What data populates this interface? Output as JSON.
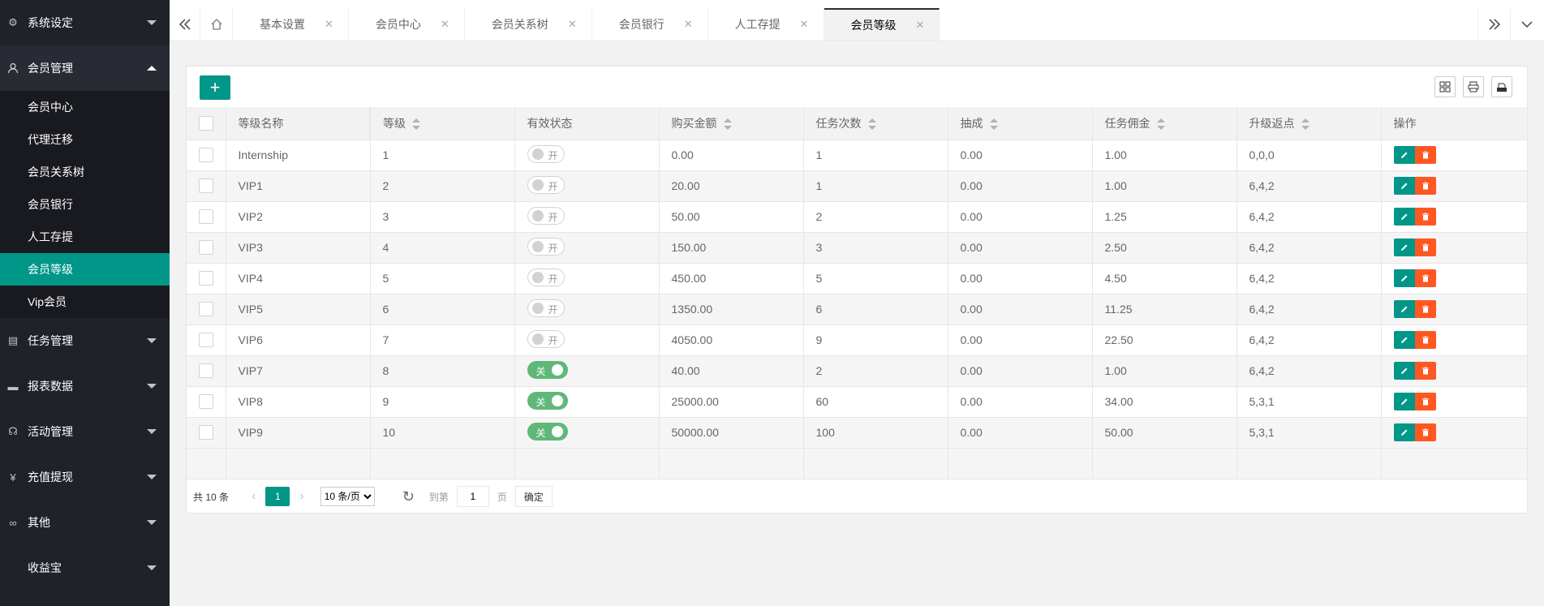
{
  "sidebar": {
    "groups": [
      {
        "label": "系统设定",
        "icon": "gear-icon"
      },
      {
        "label": "会员管理",
        "icon": "user-icon"
      },
      {
        "label": "任务管理",
        "icon": "document-icon"
      },
      {
        "label": "报表数据",
        "icon": "monitor-icon"
      },
      {
        "label": "活动管理",
        "icon": "headset-icon"
      },
      {
        "label": "充值提现",
        "icon": "yen-icon"
      },
      {
        "label": "其他",
        "icon": "link-icon"
      },
      {
        "label": "收益宝",
        "icon": ""
      }
    ],
    "member_items": [
      "会员中心",
      "代理迁移",
      "会员关系树",
      "会员银行",
      "人工存提",
      "会员等级",
      "Vip会员"
    ]
  },
  "tabs": [
    "基本设置",
    "会员中心",
    "会员关系树",
    "会员银行",
    "人工存提",
    "会员等级"
  ],
  "table": {
    "headers": [
      "等级名称",
      "等级",
      "有效状态",
      "购买金额",
      "任务次数",
      "抽成",
      "任务佣金",
      "升级返点",
      "操作"
    ],
    "rows": [
      {
        "name": "Internship",
        "level": "1",
        "status": "开",
        "amount": "0.00",
        "tasks": "1",
        "commission": "0.00",
        "task_fee": "1.00",
        "rebate": "0,0,0"
      },
      {
        "name": "VIP1",
        "level": "2",
        "status": "开",
        "amount": "20.00",
        "tasks": "1",
        "commission": "0.00",
        "task_fee": "1.00",
        "rebate": "6,4,2"
      },
      {
        "name": "VIP2",
        "level": "3",
        "status": "开",
        "amount": "50.00",
        "tasks": "2",
        "commission": "0.00",
        "task_fee": "1.25",
        "rebate": "6,4,2"
      },
      {
        "name": "VIP3",
        "level": "4",
        "status": "开",
        "amount": "150.00",
        "tasks": "3",
        "commission": "0.00",
        "task_fee": "2.50",
        "rebate": "6,4,2"
      },
      {
        "name": "VIP4",
        "level": "5",
        "status": "开",
        "amount": "450.00",
        "tasks": "5",
        "commission": "0.00",
        "task_fee": "4.50",
        "rebate": "6,4,2"
      },
      {
        "name": "VIP5",
        "level": "6",
        "status": "开",
        "amount": "1350.00",
        "tasks": "6",
        "commission": "0.00",
        "task_fee": "11.25",
        "rebate": "6,4,2"
      },
      {
        "name": "VIP6",
        "level": "7",
        "status": "开",
        "amount": "4050.00",
        "tasks": "9",
        "commission": "0.00",
        "task_fee": "22.50",
        "rebate": "6,4,2"
      },
      {
        "name": "VIP7",
        "level": "8",
        "status": "关",
        "amount": "40.00",
        "tasks": "2",
        "commission": "0.00",
        "task_fee": "1.00",
        "rebate": "6,4,2"
      },
      {
        "name": "VIP8",
        "level": "9",
        "status": "关",
        "amount": "25000.00",
        "tasks": "60",
        "commission": "0.00",
        "task_fee": "34.00",
        "rebate": "5,3,1"
      },
      {
        "name": "VIP9",
        "level": "10",
        "status": "关",
        "amount": "50000.00",
        "tasks": "100",
        "commission": "0.00",
        "task_fee": "50.00",
        "rebate": "5,3,1"
      }
    ]
  },
  "pager": {
    "count": "共 10 条",
    "current": "1",
    "size_option": "10 条/页",
    "jump_label": "到第",
    "jump_value": "1",
    "page_label": "页",
    "ok": "确定"
  },
  "colors": {
    "accent": "#009688",
    "danger": "#FF5722",
    "switch_on": "#5FB878",
    "sidebar": "#20222a"
  }
}
